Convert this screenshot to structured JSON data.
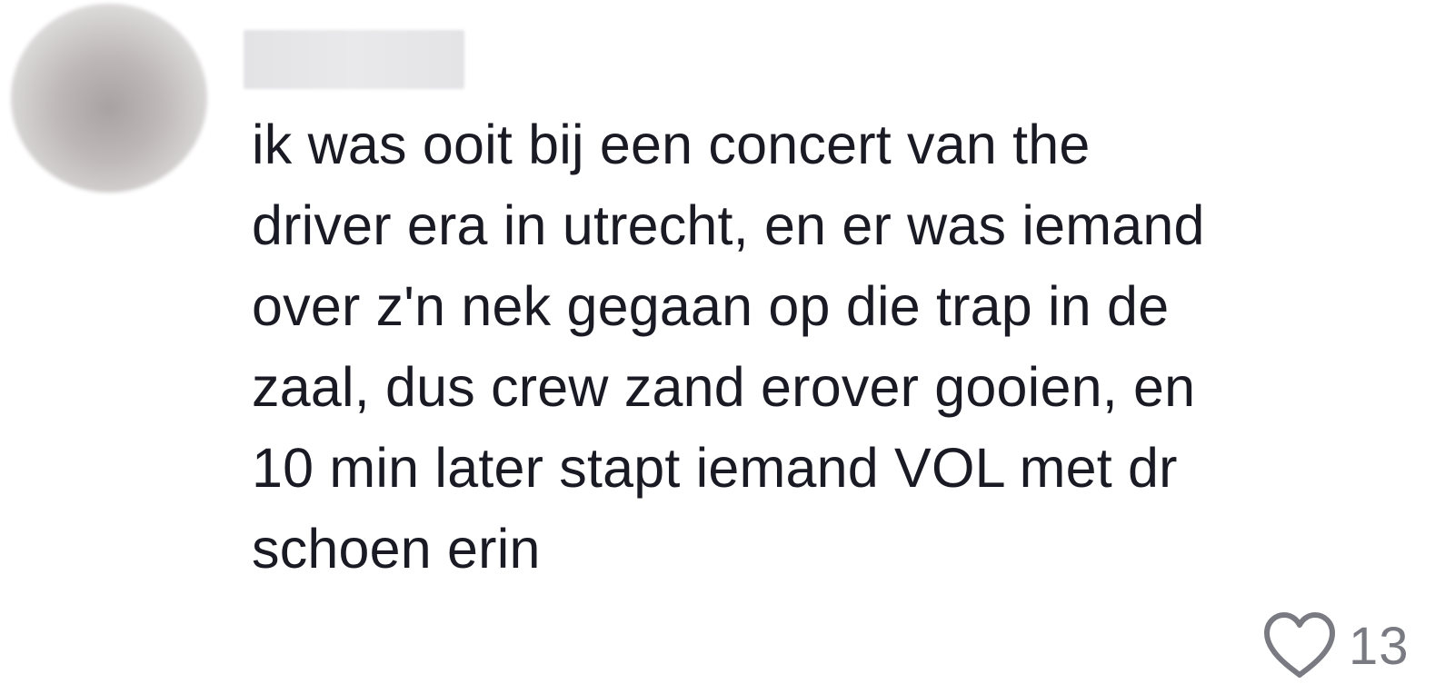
{
  "comment": {
    "text": "ik was ooit bij een concert van the\ndriver era in utrecht, en er was iemand\nover z'n nek gegaan op die trap in de\nzaal, dus crew zand erover gooien, en\n10 min later stapt iemand VOL met dr\nschoen erin",
    "like_count": "13",
    "like_icon": "heart-outline-icon"
  },
  "colors": {
    "text": "#1a1a24",
    "muted": "#7a7a82",
    "background": "#ffffff"
  }
}
